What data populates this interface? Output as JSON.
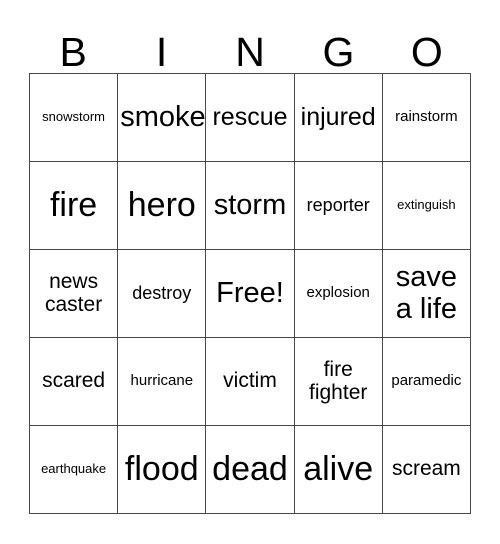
{
  "card": {
    "type": "bingo-card",
    "columns": 5,
    "rows": 5,
    "header": {
      "letters": [
        "B",
        "I",
        "N",
        "G",
        "O"
      ]
    },
    "colors": {
      "background": "#ffffff",
      "text": "#000000",
      "grid_line": "#4a4a4a"
    },
    "grid": [
      [
        {
          "text": "snowstorm",
          "size": "fs-xs"
        },
        {
          "text": "smoke",
          "size": "fs-xl"
        },
        {
          "text": "rescue",
          "size": "fs-l"
        },
        {
          "text": "injured",
          "size": "fs-l"
        },
        {
          "text": "rainstorm",
          "size": "fs-s"
        }
      ],
      [
        {
          "text": "fire",
          "size": "fs-xxl"
        },
        {
          "text": "hero",
          "size": "fs-xxl"
        },
        {
          "text": "storm",
          "size": "fs-xl"
        },
        {
          "text": "reporter",
          "size": "fs-m"
        },
        {
          "text": "extinguish",
          "size": "fs-xs"
        }
      ],
      [
        {
          "text": "news\ncaster",
          "size": "fs-ml"
        },
        {
          "text": "destroy",
          "size": "fs-m"
        },
        {
          "text": "Free!",
          "size": "fs-xl"
        },
        {
          "text": "explosion",
          "size": "fs-s"
        },
        {
          "text": "save\na life",
          "size": "fs-xl"
        }
      ],
      [
        {
          "text": "scared",
          "size": "fs-ml"
        },
        {
          "text": "hurricane",
          "size": "fs-s"
        },
        {
          "text": "victim",
          "size": "fs-ml"
        },
        {
          "text": "fire\nfighter",
          "size": "fs-ml"
        },
        {
          "text": "paramedic",
          "size": "fs-s"
        }
      ],
      [
        {
          "text": "earthquake",
          "size": "fs-xs"
        },
        {
          "text": "flood",
          "size": "fs-xxl"
        },
        {
          "text": "dead",
          "size": "fs-xxl"
        },
        {
          "text": "alive",
          "size": "fs-xxl"
        },
        {
          "text": "scream",
          "size": "fs-ml"
        }
      ]
    ]
  }
}
